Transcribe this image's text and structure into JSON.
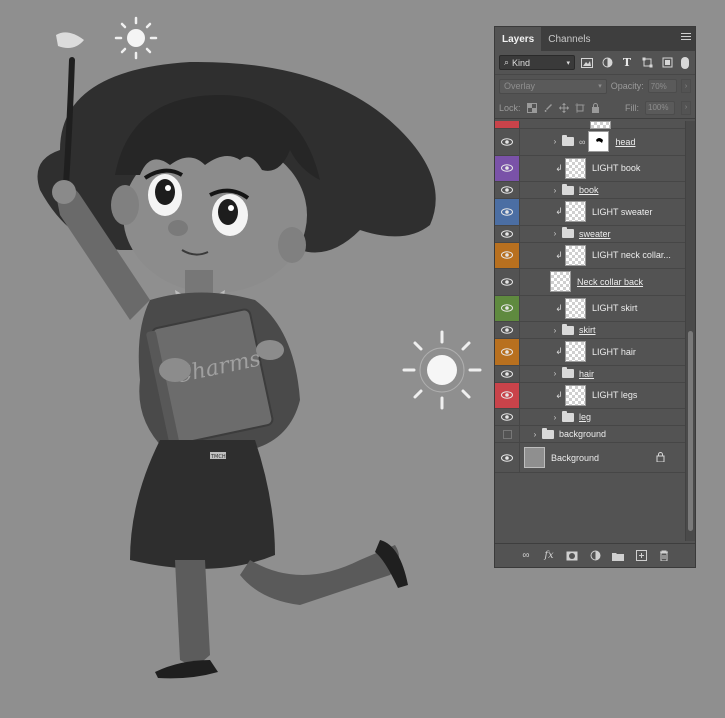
{
  "panel": {
    "tabs": [
      "Layers",
      "Channels"
    ],
    "filter_kind": "Kind",
    "blend_mode": "Overlay",
    "opacity_label": "Opacity:",
    "opacity_value": "70%",
    "lock_label": "Lock:",
    "fill_label": "Fill:",
    "fill_value": "100%"
  },
  "layers": [
    {
      "name": "",
      "type": "partial",
      "color": "#c9434a",
      "visible": true
    },
    {
      "name": "head",
      "type": "group-mask",
      "color": null,
      "visible": true,
      "underlined": true
    },
    {
      "name": "LIGHT book",
      "type": "clip",
      "color": "#7a52a8",
      "visible": true
    },
    {
      "name": "book",
      "type": "group",
      "color": null,
      "visible": true,
      "underlined": true
    },
    {
      "name": "LIGHT sweater",
      "type": "clip",
      "color": "#4b6ea3",
      "visible": true
    },
    {
      "name": "sweater",
      "type": "group",
      "color": null,
      "visible": true,
      "underlined": true
    },
    {
      "name": "LIGHT neck collar...",
      "type": "clip",
      "color": "#b8701f",
      "visible": true
    },
    {
      "name": "Neck collar back",
      "type": "layer",
      "color": null,
      "visible": true,
      "underlined": true
    },
    {
      "name": "LIGHT skirt",
      "type": "clip",
      "color": "#5f8a3f",
      "visible": true
    },
    {
      "name": "skirt",
      "type": "group",
      "color": null,
      "visible": true,
      "underlined": true
    },
    {
      "name": "LIGHT hair",
      "type": "clip",
      "color": "#b8701f",
      "visible": true
    },
    {
      "name": "hair",
      "type": "group",
      "color": null,
      "visible": true,
      "underlined": true
    },
    {
      "name": "LIGHT legs",
      "type": "clip",
      "color": "#c9434a",
      "visible": true
    },
    {
      "name": "leg",
      "type": "group",
      "color": null,
      "visible": true,
      "underlined": true
    },
    {
      "name": "background",
      "type": "group-top",
      "color": null,
      "visible": false
    },
    {
      "name": "Background",
      "type": "background",
      "color": null,
      "visible": true
    }
  ],
  "artwork": {
    "book_text": "Charms",
    "badge_text": "TMCH"
  },
  "colors": {
    "canvas": "#8f8f8f",
    "panel": "#535353",
    "panel_dark": "#3e3e3e"
  }
}
